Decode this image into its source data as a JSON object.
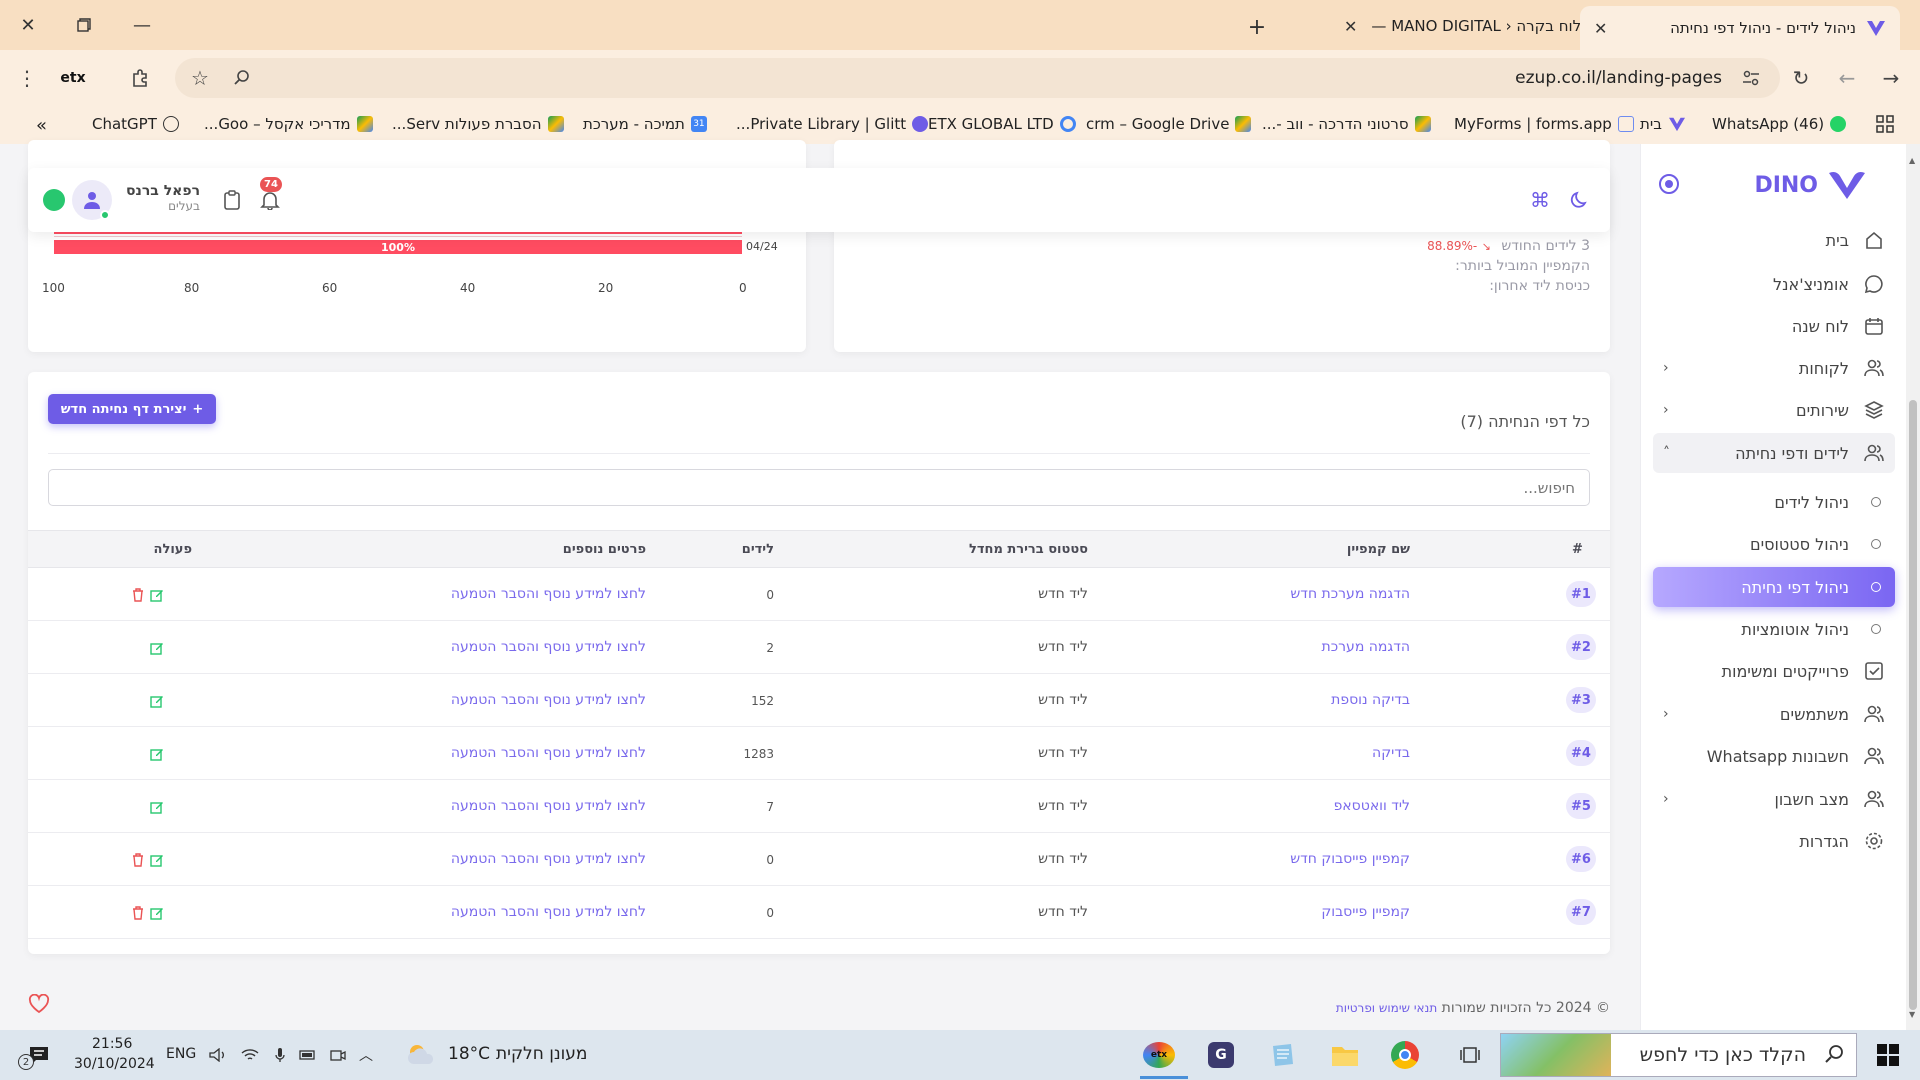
{
  "browser": {
    "tabs": [
      {
        "title": "ניהול לידים - ניהול דפי נחיתה",
        "active": true
      },
      {
        "title": "לוח בקרה ‹ MANO DIGITAL —",
        "active": false
      }
    ],
    "url": "ezup.co.il/landing-pages",
    "bookmarks": [
      "(46) WhatsApp",
      "בית",
      "MyForms | forms.app",
      "סרטוני הדרכה - ווב -...",
      "crm – Google Drive",
      "ETX GLOBAL LTD",
      "Private Library | Glitt...",
      "תמיכה - מערכת",
      "הסברת פעולות Serv...",
      "מדריכי אקסל – Goo...",
      "ChatGPT"
    ]
  },
  "sidebar": {
    "brand": "DINO",
    "items": [
      {
        "label": "בית",
        "icon": "home-icon"
      },
      {
        "label": "אומניצ'אנל",
        "icon": "chat-icon"
      },
      {
        "label": "לוח שנה",
        "icon": "calendar-icon"
      },
      {
        "label": "לקוחות",
        "icon": "users-icon"
      },
      {
        "label": "שירותים",
        "icon": "layers-icon"
      },
      {
        "label": "לידים ודפי נחיתה",
        "icon": "users-icon"
      },
      {
        "label": "ניהול לידים",
        "icon": "circle-icon"
      },
      {
        "label": "ניהול סטטוסים",
        "icon": "circle-icon"
      },
      {
        "label": "ניהול דפי נחיתה",
        "icon": "circle-icon"
      },
      {
        "label": "ניהול אוטומציות",
        "icon": "circle-icon"
      },
      {
        "label": "פרוייקטים ומשימות",
        "icon": "checkbox-icon"
      },
      {
        "label": "משתמשים",
        "icon": "users-icon"
      },
      {
        "label": "חשבונות Whatsapp",
        "icon": "users-icon"
      },
      {
        "label": "מצב חשבון",
        "icon": "users-icon"
      },
      {
        "label": "הגדרות",
        "icon": "settings-icon"
      }
    ]
  },
  "topbar": {
    "user_name": "רפאל ברנס",
    "user_role": "בעלים",
    "notifications_count": "74"
  },
  "chart": {
    "bar_label_top": "100%",
    "bar_label": "100%",
    "bar_date": "04/24",
    "ticks": [
      "100",
      "80",
      "60",
      "40",
      "20",
      "0"
    ]
  },
  "chart_data": {
    "type": "bar",
    "categories": [
      "",
      "04/24"
    ],
    "values": [
      100,
      100
    ],
    "xlim": [
      100,
      0
    ],
    "ticks": [
      100,
      80,
      60,
      40,
      20,
      0
    ]
  },
  "stats": {
    "leads_month": "3 לידים החודש",
    "change": "-88.89%",
    "top_campaign": "הקמפיין המוביל ביותר:",
    "last_lead": "כניסת ליד אחרון:"
  },
  "landing": {
    "create_button": "יצירת דף נחיתה חדש",
    "title": "כל דפי הנחיתה (7)",
    "search_placeholder": "חיפוש...",
    "columns": {
      "id": "#",
      "name": "שם קמפיין",
      "status": "סטטוס ברירת מחדל",
      "leads": "לידים",
      "details": "פרטים נוספים",
      "action": "פעולה"
    },
    "rows": [
      {
        "id": "#1",
        "name": "הדגמה מערכת חדש",
        "status": "ליד חדש",
        "leads": "0",
        "details": "לחצו למידע נוסף והסבר הטמעה"
      },
      {
        "id": "#2",
        "name": "הדגמה מערכת",
        "status": "ליד חדש",
        "leads": "2",
        "details": "לחצו למידע נוסף והסבר הטמעה"
      },
      {
        "id": "#3",
        "name": "בדיקה נוספת",
        "status": "ליד חדש",
        "leads": "152",
        "details": "לחצו למידע נוסף והסבר הטמעה"
      },
      {
        "id": "#4",
        "name": "בדיקה",
        "status": "ליד חדש",
        "leads": "1283",
        "details": "לחצו למידע נוסף והסבר הטמעה"
      },
      {
        "id": "#5",
        "name": "ליד וואטסאפ",
        "status": "ליד חדש",
        "leads": "7",
        "details": "לחצו למידע נוסף והסבר הטמעה"
      },
      {
        "id": "#6",
        "name": "קמפיין פייסבוק חדש",
        "status": "ליד חדש",
        "leads": "0",
        "details": "לחצו למידע נוסף והסבר הטמעה"
      },
      {
        "id": "#7",
        "name": "קמפיין פייסבוק",
        "status": "ליד חדש",
        "leads": "0",
        "details": "לחצו למידע נוסף והסבר הטמעה"
      }
    ]
  },
  "footer": {
    "copyright": "© 2024 כל הזכויות שמורות",
    "terms": "תנאי שימוש ופרטיות"
  },
  "taskbar": {
    "search": "הקלד כאן כדי לחפש",
    "weather_text": "מעונן חלקית",
    "temperature": "18°C",
    "lang": "ENG",
    "time": "21:56",
    "date": "30/10/2024",
    "notif_count": "2"
  },
  "colors": {
    "accent": "#6e5ce6",
    "bar": "#ff4c61",
    "delete": "#ea5455",
    "edit": "#28c76f"
  }
}
